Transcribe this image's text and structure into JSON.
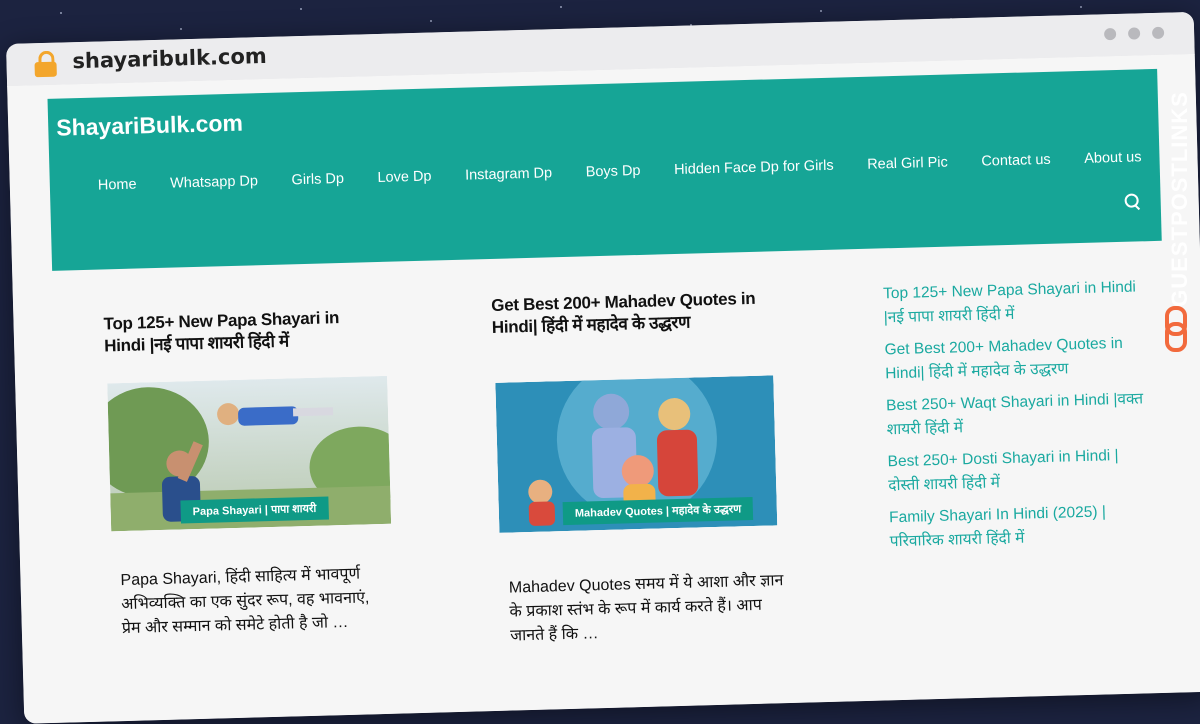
{
  "browser": {
    "url": "shayaribulk.com"
  },
  "site": {
    "logo": "ShayariBulk.com",
    "nav": [
      "Home",
      "Whatsapp Dp",
      "Girls Dp",
      "Love Dp",
      "Instagram Dp",
      "Boys Dp",
      "Hidden Face Dp for Girls",
      "Real Girl Pic",
      "Contact us",
      "About us"
    ]
  },
  "posts": [
    {
      "title": "Top 125+ New Papa Shayari in Hindi |नई पापा शायरी हिंदी में",
      "image_caption": "Papa Shayari | पापा शायरी",
      "excerpt": "Papa Shayari, हिंदी साहित्य में भावपूर्ण अभिव्यक्ति का एक सुंदर रूप, वह भावनाएं, प्रेम और सम्मान को समेटे होती है जो …"
    },
    {
      "title": "Get Best 200+ Mahadev Quotes in Hindi| हिंदी में महादेव के उद्धरण",
      "image_caption": "Mahadev Quotes | महादेव के उद्धरण",
      "excerpt": "Mahadev Quotes समय में ये आशा और ज्ञान के प्रकाश स्तंभ के रूप में कार्य करते हैं। आप जानते हैं कि …"
    }
  ],
  "sidebar": {
    "links": [
      "Top 125+ New Papa Shayari in Hindi |नई पापा शायरी हिंदी में",
      "Get Best 200+ Mahadev Quotes in Hindi| हिंदी में महादेव के उद्धरण",
      "Best 250+ Waqt Shayari in Hindi |वक्त शायरी हिंदी में",
      "Best 250+ Dosti Shayari in Hindi | दोस्ती शायरी हिंदी में",
      "Family Shayari In Hindi (2025) | परिवारिक शायरी हिंदी में"
    ]
  },
  "badge": {
    "text": "GUESTPOSTLINKS"
  },
  "colors": {
    "header": "#16a596",
    "link": "#1aa9a0",
    "background": "#1c2340",
    "badge_accent": "#f26a3d"
  }
}
